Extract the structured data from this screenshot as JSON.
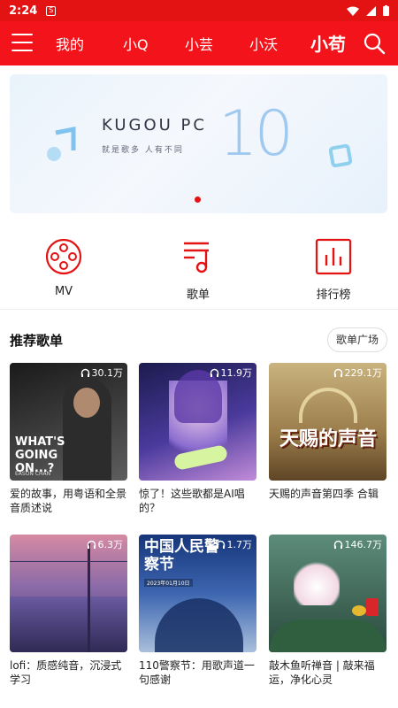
{
  "status": {
    "time": "2:24",
    "notif_glyph": "S"
  },
  "nav": {
    "tabs": [
      "我的",
      "小Q",
      "小芸",
      "小沃",
      "小苟"
    ],
    "active_index": 4
  },
  "banner": {
    "brand": "KUGOU PC",
    "version": "10",
    "slogan": "就是歌多  人有不同"
  },
  "quick_links": [
    {
      "label": "MV",
      "icon": "film-reel-icon"
    },
    {
      "label": "歌单",
      "icon": "music-playlist-icon"
    },
    {
      "label": "排行榜",
      "icon": "chart-bars-icon"
    }
  ],
  "section": {
    "title": "推荐歌单",
    "more_button": "歌单广场"
  },
  "playlists": [
    {
      "count": "30.1万",
      "title": "爱的故事，用粤语和全景音质述说",
      "cover_text": "WHAT'S GOING ON...?",
      "cover_sub": "EASON CHAN",
      "color1": "#2b2b2b",
      "color2": "#6c6c6c"
    },
    {
      "count": "11.9万",
      "title": "惊了！这些歌都是AI唱的？",
      "cover_text": "",
      "cover_sub": "",
      "color1": "#26245c",
      "color2": "#8a5fc4"
    },
    {
      "count": "229.1万",
      "title": "天赐的声音第四季 合辑",
      "cover_text": "天赐的声音",
      "cover_sub": "",
      "color1": "#7a5b2c",
      "color2": "#d8c494"
    },
    {
      "count": "6.3万",
      "title": "lofi：质感纯音，沉浸式学习",
      "cover_text": "",
      "cover_sub": "",
      "color1": "#4b3c7a",
      "color2": "#d489a6"
    },
    {
      "count": "1.7万",
      "title": "110警察节：用歌声道一句感谢",
      "cover_text": "中国人民警察节",
      "cover_sub": "2023年01月10日",
      "color1": "#1f3f8a",
      "color2": "#9fb6d8"
    },
    {
      "count": "146.7万",
      "title": "敲木鱼听禅音 | 敲来福运，净化心灵",
      "cover_text": "",
      "cover_sub": "",
      "color1": "#2e4a3d",
      "color2": "#88b3a0"
    }
  ]
}
